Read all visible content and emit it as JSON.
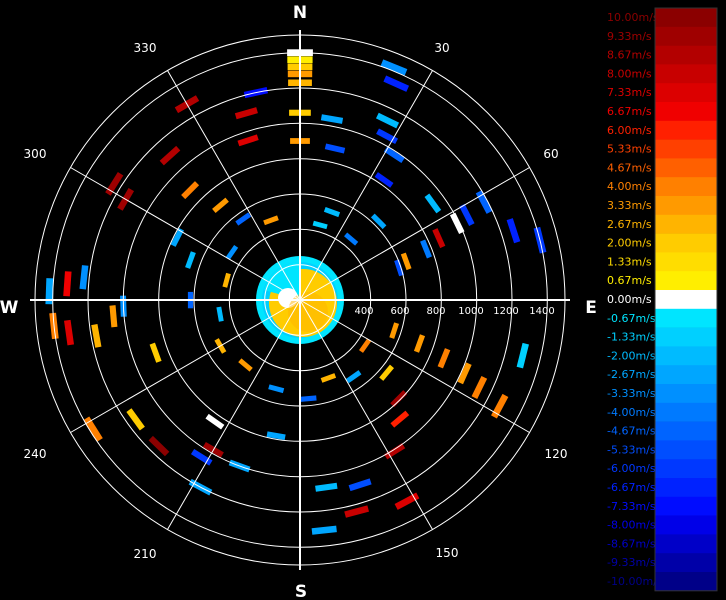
{
  "chart_data": {
    "type": "polar_radar_velocity",
    "cardinals": [
      "N",
      "E",
      "S",
      "W"
    ],
    "azimuth_labels": [
      "30",
      "60",
      "120",
      "150",
      "210",
      "240",
      "300",
      "330"
    ],
    "range_labels": [
      "400",
      "600",
      "800",
      "1000",
      "1200",
      "1400"
    ],
    "range_max": 1500,
    "ring_ranges": [
      200,
      400,
      600,
      800,
      1000,
      1200,
      1400
    ],
    "spokes_deg": [
      0,
      30,
      60,
      90,
      120,
      150,
      180,
      210,
      240,
      270,
      300,
      330
    ],
    "grid": true,
    "colorbar": {
      "labels": [
        "10.00m/s",
        "9.33m/s",
        "8.67m/s",
        "8.00m/s",
        "7.33m/s",
        "6.67m/s",
        "6.00m/s",
        "5.33m/s",
        "4.67m/s",
        "4.00m/s",
        "3.33m/s",
        "2.67m/s",
        "2.00m/s",
        "1.33m/s",
        "0.67m/s",
        "0.00m/s",
        "-0.67m/s",
        "-1.33m/s",
        "-2.00m/s",
        "-2.67m/s",
        "-3.33m/s",
        "-4.00m/s",
        "-4.67m/s",
        "-5.33m/s",
        "-6.00m/s",
        "-6.67m/s",
        "-7.33m/s",
        "-8.00m/s",
        "-8.67m/s",
        "-9.33m/s",
        "-10.00m/s"
      ],
      "colors": [
        "#8b0000",
        "#9f0000",
        "#b30000",
        "#c80000",
        "#dc0000",
        "#f00000",
        "#ff2000",
        "#ff4000",
        "#ff6000",
        "#ff8000",
        "#ff9a00",
        "#ffb400",
        "#ffcc00",
        "#ffdd00",
        "#ffee00",
        "#ffffff",
        "#00e5ff",
        "#00d0ff",
        "#00bbff",
        "#00a6ff",
        "#0090ff",
        "#007aff",
        "#0064ff",
        "#004eff",
        "#0038ff",
        "#0022ff",
        "#000cff",
        "#0000e8",
        "#0000c8",
        "#0000a8",
        "#000088"
      ]
    },
    "returns": [
      {
        "az": 0,
        "range": 1400,
        "velocity": 0.0
      },
      {
        "az": 0,
        "range": 1360,
        "velocity": 0.67
      },
      {
        "az": 0,
        "range": 1320,
        "velocity": 2.0
      },
      {
        "az": 0,
        "range": 1280,
        "velocity": 3.33
      },
      {
        "az": 0,
        "range": 1230,
        "velocity": 2.67
      },
      {
        "az": 0,
        "range": 1060,
        "velocity": 2.0
      },
      {
        "az": 0,
        "range": 900,
        "velocity": 3.33
      },
      {
        "az": 22,
        "range": 1420,
        "velocity": -3.33
      },
      {
        "az": 24,
        "range": 1340,
        "velocity": -6.67
      },
      {
        "az": 26,
        "range": 1130,
        "velocity": -2.0
      },
      {
        "az": 28,
        "range": 1050,
        "velocity": -6.0
      },
      {
        "az": 33,
        "range": 980,
        "velocity": -4.67
      },
      {
        "az": 35,
        "range": 830,
        "velocity": -6.67
      },
      {
        "az": 10,
        "range": 1040,
        "velocity": -2.67
      },
      {
        "az": 13,
        "range": 880,
        "velocity": -5.33
      },
      {
        "az": -12,
        "range": 1200,
        "velocity": -7.33
      },
      {
        "az": -16,
        "range": 1100,
        "velocity": 8.0
      },
      {
        "az": -18,
        "range": 950,
        "velocity": 7.33
      },
      {
        "az": -30,
        "range": 1280,
        "velocity": 8.67
      },
      {
        "az": -42,
        "range": 1100,
        "velocity": 8.67
      },
      {
        "az": -45,
        "range": 880,
        "velocity": 4.0
      },
      {
        "az": -40,
        "range": 700,
        "velocity": 3.33
      },
      {
        "az": -58,
        "range": 1240,
        "velocity": 9.33
      },
      {
        "az": -60,
        "range": 1140,
        "velocity": 9.33
      },
      {
        "az": -63,
        "range": 780,
        "velocity": -2.67
      },
      {
        "az": -70,
        "range": 660,
        "velocity": -2.0
      },
      {
        "az": -88,
        "range": 1420,
        "velocity": -2.67
      },
      {
        "az": -86,
        "range": 1320,
        "velocity": 6.67
      },
      {
        "az": -84,
        "range": 1230,
        "velocity": -3.33
      },
      {
        "az": -96,
        "range": 1400,
        "velocity": 4.0
      },
      {
        "az": -98,
        "range": 1320,
        "velocity": 7.33
      },
      {
        "az": -100,
        "range": 1170,
        "velocity": 2.67
      },
      {
        "az": -92,
        "range": 1000,
        "velocity": -3.33
      },
      {
        "az": -95,
        "range": 1060,
        "velocity": 3.33
      },
      {
        "az": -90,
        "range": 620,
        "velocity": -4.67
      },
      {
        "az": -110,
        "range": 870,
        "velocity": 2.0
      },
      {
        "az": -122,
        "range": 1380,
        "velocity": 4.0
      },
      {
        "az": -126,
        "range": 1150,
        "velocity": 2.0
      },
      {
        "az": -136,
        "range": 1150,
        "velocity": 10.0
      },
      {
        "az": -148,
        "range": 1050,
        "velocity": -6.0
      },
      {
        "az": -150,
        "range": 980,
        "velocity": 9.33
      },
      {
        "az": -152,
        "range": 1200,
        "velocity": -2.67
      },
      {
        "az": -145,
        "range": 840,
        "velocity": 0.0
      },
      {
        "az": -160,
        "range": 1000,
        "velocity": -2.67
      },
      {
        "az": -170,
        "range": 780,
        "velocity": -2.67
      },
      {
        "az": 172,
        "range": 1070,
        "velocity": -2.0
      },
      {
        "az": 174,
        "range": 1310,
        "velocity": -2.67
      },
      {
        "az": 165,
        "range": 1240,
        "velocity": 8.0
      },
      {
        "az": 162,
        "range": 1100,
        "velocity": -5.33
      },
      {
        "az": 152,
        "range": 1290,
        "velocity": 7.33
      },
      {
        "az": 148,
        "range": 1010,
        "velocity": 8.67
      },
      {
        "az": 140,
        "range": 880,
        "velocity": 6.0
      },
      {
        "az": 135,
        "range": 790,
        "velocity": 9.33
      },
      {
        "az": 130,
        "range": 640,
        "velocity": 2.0
      },
      {
        "az": 118,
        "range": 1280,
        "velocity": 4.0
      },
      {
        "az": 116,
        "range": 1130,
        "velocity": 4.0
      },
      {
        "az": 114,
        "range": 1020,
        "velocity": 3.33
      },
      {
        "az": 112,
        "range": 880,
        "velocity": 4.0
      },
      {
        "az": 110,
        "range": 720,
        "velocity": 3.33
      },
      {
        "az": 108,
        "range": 560,
        "velocity": 3.33
      },
      {
        "az": 104,
        "range": 1300,
        "velocity": -1.33
      },
      {
        "az": 62,
        "range": 1180,
        "velocity": -4.67
      },
      {
        "az": 63,
        "range": 1060,
        "velocity": -6.0
      },
      {
        "az": 64,
        "range": 990,
        "velocity": 0.0
      },
      {
        "az": 66,
        "range": 860,
        "velocity": 8.0
      },
      {
        "az": 68,
        "range": 770,
        "velocity": -4.0
      },
      {
        "az": 70,
        "range": 640,
        "velocity": 3.33
      },
      {
        "az": 72,
        "range": 590,
        "velocity": -5.33
      },
      {
        "az": 76,
        "range": 1400,
        "velocity": -6.0
      },
      {
        "az": 72,
        "range": 1270,
        "velocity": -6.67
      },
      {
        "az": 54,
        "range": 930,
        "velocity": -2.0
      },
      {
        "az": 45,
        "range": 630,
        "velocity": -2.67
      },
      {
        "az": 40,
        "range": 450,
        "velocity": -4.0
      },
      {
        "az": 20,
        "range": 530,
        "velocity": -2.0
      },
      {
        "az": 15,
        "range": 440,
        "velocity": -1.33
      },
      {
        "az": -20,
        "range": 480,
        "velocity": 3.33
      },
      {
        "az": -35,
        "range": 560,
        "velocity": -4.67
      },
      {
        "az": -55,
        "range": 470,
        "velocity": -3.33
      },
      {
        "az": -75,
        "range": 430,
        "velocity": 2.67
      },
      {
        "az": -100,
        "range": 460,
        "velocity": -2.0
      },
      {
        "az": -120,
        "range": 520,
        "velocity": 2.67
      },
      {
        "az": -140,
        "range": 480,
        "velocity": 3.33
      },
      {
        "az": -165,
        "range": 520,
        "velocity": -3.33
      },
      {
        "az": 175,
        "range": 560,
        "velocity": -4.67
      },
      {
        "az": 160,
        "range": 470,
        "velocity": 2.67
      },
      {
        "az": 145,
        "range": 530,
        "velocity": -2.67
      },
      {
        "az": 125,
        "range": 450,
        "velocity": 4.0
      }
    ]
  }
}
